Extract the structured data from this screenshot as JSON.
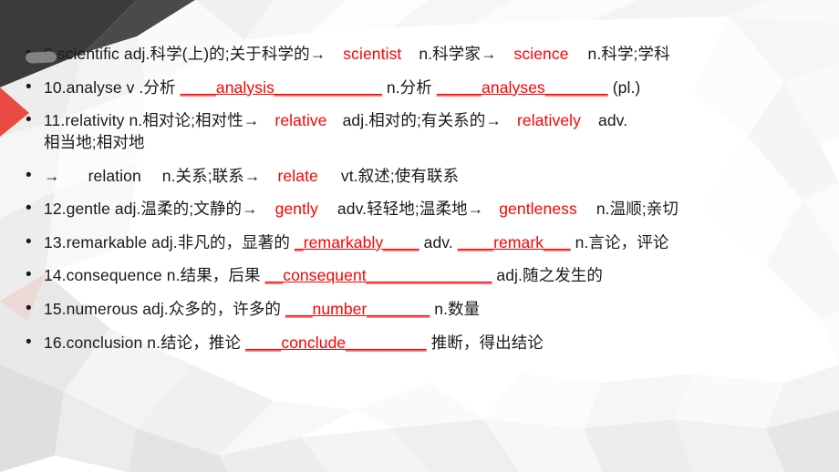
{
  "slide": {
    "background_colors": {
      "base": "#ffffff",
      "light_grey": "#f1f1f1",
      "mid_grey": "#e2e2e2",
      "dark_grey": "#d2d2d2",
      "charcoal": "#3b3b3b",
      "accent_red": "#e8392f"
    },
    "accent_text_color": "#ff0000",
    "body_text_color": "#1a1a1a"
  },
  "annotations": {
    "scribble_over": "9."
  },
  "items": [
    {
      "number": "9.",
      "parts": [
        {
          "text": "9.scientific adj.科学(上)的;关于科学的→",
          "style": "plain"
        },
        {
          "text": "scientist",
          "style": "red"
        },
        {
          "text": "n.科学家→",
          "style": "plain"
        },
        {
          "text": "science",
          "style": "red"
        },
        {
          "text": "n.科学;学科",
          "style": "plain"
        }
      ]
    },
    {
      "number": "10.",
      "parts": [
        {
          "text": "10.analyse v .分析",
          "style": "plain"
        },
        {
          "text": "____analysis____________",
          "style": "red-underline"
        },
        {
          "text": "n.分析",
          "style": "plain"
        },
        {
          "text": "_____analyses_______",
          "style": "red-underline"
        },
        {
          "text": "(pl.)",
          "style": "plain"
        }
      ]
    },
    {
      "number": "11.",
      "parts": [
        {
          "text": "11.relativity n.相对论;相对性→",
          "style": "plain"
        },
        {
          "text": "relative",
          "style": "red"
        },
        {
          "text": "adj.相对的;有关系的→",
          "style": "plain"
        },
        {
          "text": "relatively",
          "style": "red"
        },
        {
          "text": "adv.相当地;相对地",
          "style": "plain"
        }
      ]
    },
    {
      "number": "",
      "parts": [
        {
          "text": "→",
          "style": "plain"
        },
        {
          "text": "relation",
          "style": "plain"
        },
        {
          "text": "n.关系;联系→",
          "style": "plain"
        },
        {
          "text": "relate",
          "style": "red"
        },
        {
          "text": "vt.叙述;使有联系",
          "style": "plain"
        }
      ]
    },
    {
      "number": "12.",
      "parts": [
        {
          "text": "12.gentle adj.温柔的;文静的→",
          "style": "plain"
        },
        {
          "text": "gently",
          "style": "red"
        },
        {
          "text": "adv.轻轻地;温柔地→",
          "style": "plain"
        },
        {
          "text": "gentleness",
          "style": "red"
        },
        {
          "text": "n.温顺;亲切",
          "style": "plain"
        }
      ]
    },
    {
      "number": "13.",
      "parts": [
        {
          "text": "13.remarkable adj.非凡的，显著的",
          "style": "plain"
        },
        {
          "text": "_remarkably____",
          "style": "red-underline"
        },
        {
          "text": "adv.",
          "style": "plain"
        },
        {
          "text": "____remark___",
          "style": "red-underline"
        },
        {
          "text": "n.言论，评论",
          "style": "plain"
        }
      ]
    },
    {
      "number": "14.",
      "parts": [
        {
          "text": "14.consequence n.结果，后果",
          "style": "plain"
        },
        {
          "text": "__consequent______________",
          "style": "red-underline"
        },
        {
          "text": "adj.随之发生的",
          "style": "plain"
        }
      ]
    },
    {
      "number": "15.",
      "parts": [
        {
          "text": "15.numerous adj.众多的，许多的",
          "style": "plain"
        },
        {
          "text": "___number_______",
          "style": "red-underline"
        },
        {
          "text": "n.数量",
          "style": "plain"
        }
      ]
    },
    {
      "number": "16.",
      "parts": [
        {
          "text": "16.conclusion n.结论，推论",
          "style": "plain"
        },
        {
          "text": "____conclude_________",
          "style": "red-underline"
        },
        {
          "text": "推断，得出结论",
          "style": "plain"
        }
      ]
    }
  ],
  "lines": {
    "l1_a": "9.scientific adj.科学(上)的;关于科学的→",
    "l1_b": "scientist",
    "l1_c": "n.科学家→",
    "l1_d": "science",
    "l1_e": "n.科学;学科",
    "l2_a": "10.analyse v .分析",
    "l2_b": "____analysis____________",
    "l2_c": "n.分析",
    "l2_d": "_____analyses_______",
    "l2_e": "(pl.)",
    "l3_a": "11.relativity n.相对论;相对性→",
    "l3_b": "relative",
    "l3_c": "adj.相对的;有关系的→",
    "l3_d": "relatively",
    "l3_e": "adv.",
    "l3_f": "相当地;相对地",
    "l4_a": "→",
    "l4_b": "relation",
    "l4_c": "n.关系;联系→",
    "l4_d": "relate",
    "l4_e": "vt.叙述;使有联系",
    "l5_a": "12.gentle adj.温柔的;文静的→",
    "l5_b": "gently",
    "l5_c": "adv.轻轻地;温柔地→",
    "l5_d": "gentleness",
    "l5_e": "n.温顺;亲切",
    "l6_a": "13.remarkable adj.非凡的，显著的",
    "l6_b": "_remarkably____",
    "l6_c": "adv.",
    "l6_d": "____remark___",
    "l6_e": "n.言论，评论",
    "l7_a": "14.consequence n.结果，后果",
    "l7_b": "__consequent______________",
    "l7_c": "adj.随之发生的",
    "l8_a": "15.numerous adj.众多的，许多的",
    "l8_b": "___number_______",
    "l8_c": "n.数量",
    "l9_a": "16.conclusion n.结论，推论",
    "l9_b": "____conclude_________",
    "l9_c": "推断，得出结论"
  }
}
